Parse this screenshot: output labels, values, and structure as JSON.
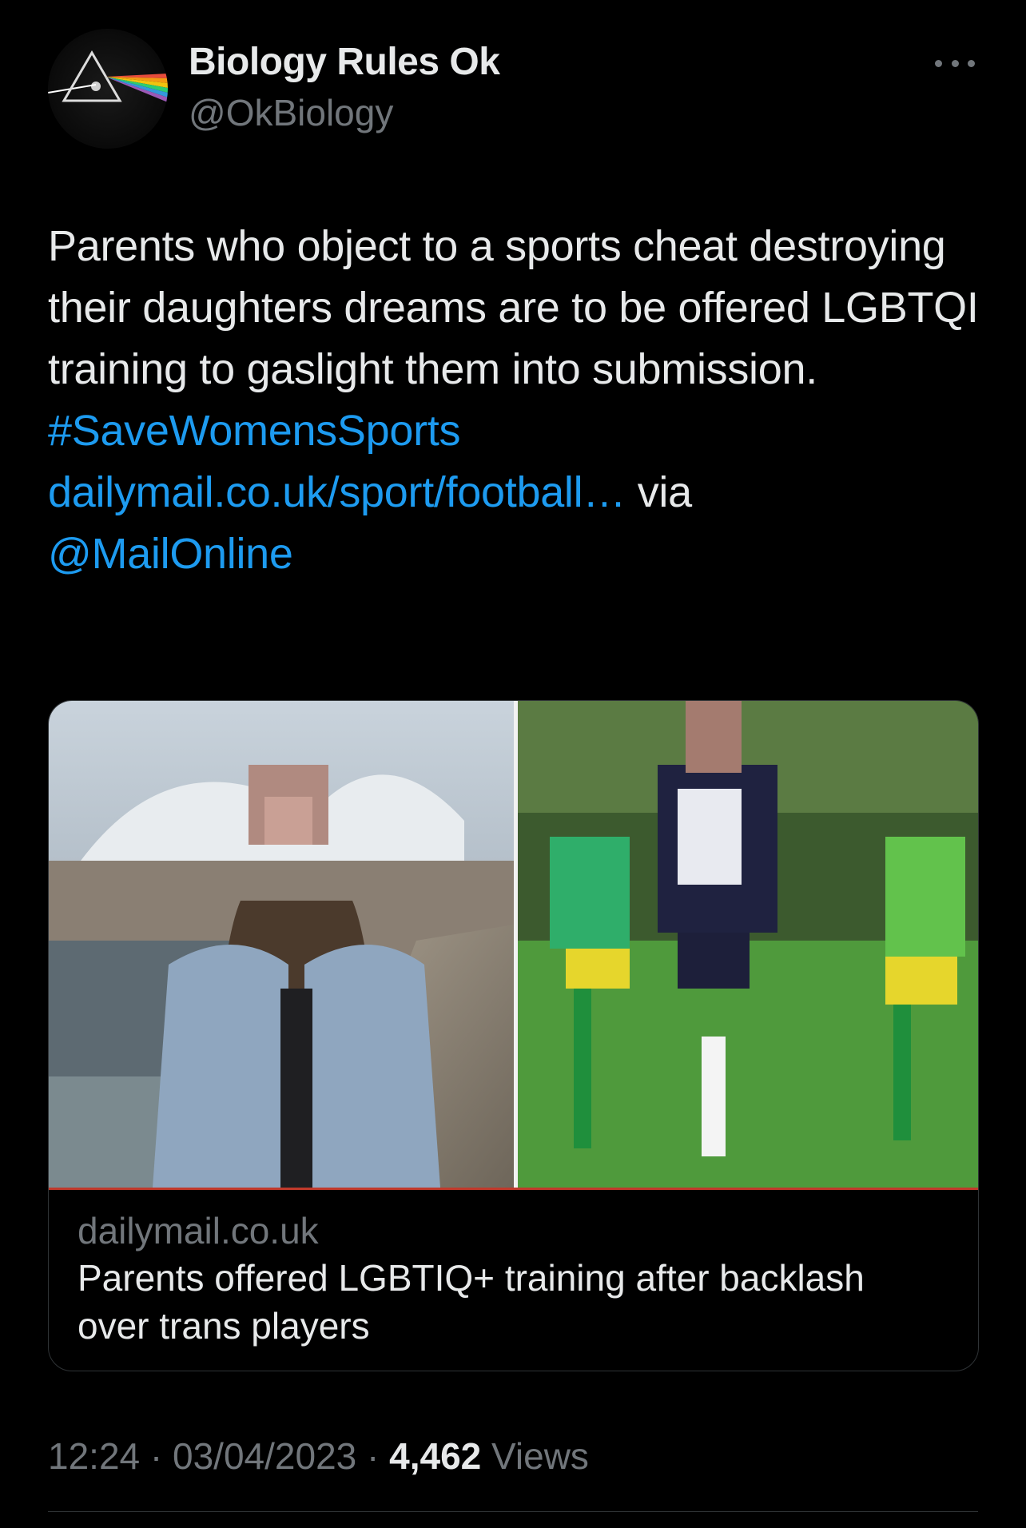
{
  "author": {
    "display_name": "Biology Rules Ok",
    "handle": "@OkBiology",
    "avatar_icon": "prism-rainbow-icon"
  },
  "tweet": {
    "text": "Parents who object to a sports cheat destroying their daughters dreams are to be offered LGBTQI training to gaslight them into submission.",
    "hashtag": "#SaveWomensSports",
    "link_text": "dailymail.co.uk/sport/football…",
    "via_text": "via",
    "mention": "@MailOnline"
  },
  "card": {
    "domain": "dailymail.co.uk",
    "title": "Parents offered LGBTIQ+ training after backlash over trans players"
  },
  "meta": {
    "time": "12:24",
    "separator": "·",
    "date": "03/04/2023",
    "views_count": "4,462",
    "views_label": "Views"
  },
  "colors": {
    "background": "#000000",
    "text": "#e7e9ea",
    "muted": "#71767b",
    "link": "#1d9bf0",
    "border": "#2f3336"
  }
}
